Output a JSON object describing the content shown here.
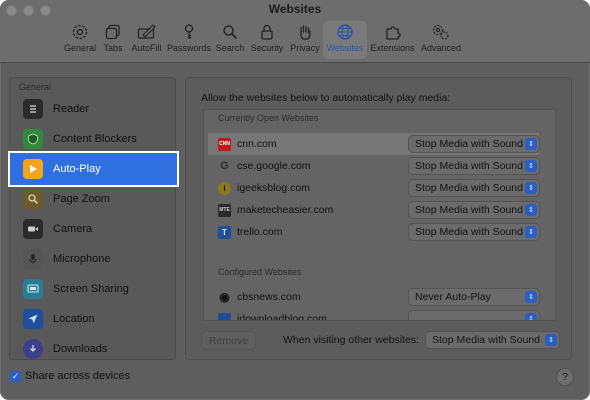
{
  "window": {
    "title": "Websites"
  },
  "toolbar": {
    "items": [
      {
        "label": "General",
        "icon": "gear-icon"
      },
      {
        "label": "Tabs",
        "icon": "tabs-icon"
      },
      {
        "label": "AutoFill",
        "icon": "pencil-icon"
      },
      {
        "label": "Passwords",
        "icon": "key-icon"
      },
      {
        "label": "Search",
        "icon": "magnifier-icon"
      },
      {
        "label": "Security",
        "icon": "lock-icon"
      },
      {
        "label": "Privacy",
        "icon": "hand-icon"
      },
      {
        "label": "Websites",
        "icon": "globe-icon",
        "active": true
      },
      {
        "label": "Extensions",
        "icon": "puzzle-icon"
      },
      {
        "label": "Advanced",
        "icon": "gears-icon"
      }
    ]
  },
  "sidebar": {
    "header": "General",
    "items": [
      {
        "label": "Reader",
        "icon": "reader-icon",
        "color": "#2b2b2b"
      },
      {
        "label": "Content Blockers",
        "icon": "shield-icon",
        "color": "#2f8a3a"
      },
      {
        "label": "Auto-Play",
        "icon": "play-icon",
        "color": "#f2a516",
        "active": true
      },
      {
        "label": "Page Zoom",
        "icon": "magnifier-icon",
        "color": "#6b5a2a"
      },
      {
        "label": "Camera",
        "icon": "camera-icon",
        "color": "#2b2b2b"
      },
      {
        "label": "Microphone",
        "icon": "microphone-icon",
        "color": "#555555"
      },
      {
        "label": "Screen Sharing",
        "icon": "screen-sharing-icon",
        "color": "#2a7d92"
      },
      {
        "label": "Location",
        "icon": "location-icon",
        "color": "#1f4f9c"
      },
      {
        "label": "Downloads",
        "icon": "downloads-icon",
        "color": "#3c3f8a"
      }
    ]
  },
  "main": {
    "label": "Allow the websites below to automatically play media:",
    "open_header": "Currently Open Websites",
    "open_sites": [
      {
        "site": "cnn.com",
        "value": "Stop Media with Sound",
        "favicon": "CNN",
        "fav_bg": "#c01a1a",
        "fav_fg": "#ffffff",
        "selected": true
      },
      {
        "site": "cse.google.com",
        "value": "Stop Media with Sound",
        "favicon": "G",
        "fav_bg": "transparent",
        "fav_fg": "#2c2c2c"
      },
      {
        "site": "igeeksblog.com",
        "value": "Stop Media with Sound",
        "favicon": "i",
        "fav_bg": "#8a7a1e",
        "fav_fg": "#111111"
      },
      {
        "site": "maketecheasier.com",
        "value": "Stop Media with Sound",
        "favicon": "MTE",
        "fav_bg": "#2a2a2a",
        "fav_fg": "#cfcfcf"
      },
      {
        "site": "trello.com",
        "value": "Stop Media with Sound",
        "favicon": "T",
        "fav_bg": "#1e4f96",
        "fav_fg": "#d8e2f2"
      }
    ],
    "configured_header": "Configured Websites",
    "configured_sites": [
      {
        "site": "cbsnews.com",
        "value": "Never Auto-Play",
        "favicon": "◉",
        "fav_bg": "transparent",
        "fav_fg": "#111111"
      },
      {
        "site": "idownloadblog.com",
        "value": "",
        "favicon": "",
        "fav_bg": "#1e4f96",
        "fav_fg": "#d8e2f2"
      }
    ],
    "remove_label": "Remove",
    "other_label": "When visiting other websites:",
    "other_value": "Stop Media with Sound"
  },
  "footer": {
    "share_label": "Share across devices",
    "share_checked": true,
    "help_label": "?"
  }
}
